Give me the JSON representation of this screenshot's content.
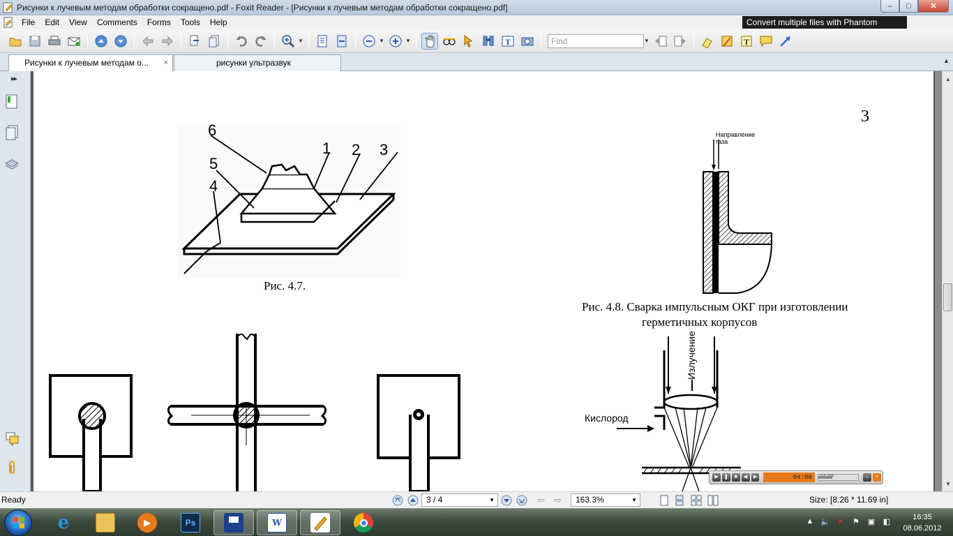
{
  "window": {
    "title": "Рисунки к лучевым методам обработки сокращено.pdf - Foxit Reader - [Рисунки к лучевым методам обработки сокращено.pdf]",
    "min": "–",
    "max": "□",
    "close": "✕"
  },
  "menu": {
    "items": [
      "File",
      "Edit",
      "View",
      "Comments",
      "Forms",
      "Tools",
      "Help"
    ],
    "promo": "Convert multiple files with Phantom"
  },
  "toolbar": {
    "find_placeholder": "Find",
    "icons": [
      "open-icon",
      "save-icon",
      "print-icon",
      "email-icon",
      "prev-page-icon",
      "next-page-icon",
      "back-icon",
      "forward-icon",
      "extract-icon",
      "insert-icon",
      "undo-icon",
      "redo-icon",
      "zoom-in-icon",
      "fit-page-icon",
      "fit-width-icon",
      "zoom-out-icon",
      "zoom-plus-icon",
      "hand-icon",
      "select-text-icon",
      "select-annotation-icon",
      "find-icon",
      "typewriter-icon",
      "snapshot-icon",
      "prev-find-icon",
      "next-find-icon",
      "highlight-icon",
      "note-icon",
      "textbox-icon",
      "comment-icon",
      "arrow-icon"
    ]
  },
  "tabs": [
    {
      "label": "Рисунки к лучевым методам о...",
      "active": true,
      "close": "×"
    },
    {
      "label": "рисунки ультразвук",
      "active": false
    }
  ],
  "document": {
    "page_number": "3",
    "figures": {
      "fig47": {
        "labels": [
          "6",
          "1",
          "2",
          "3",
          "5",
          "4"
        ],
        "caption": "Рис. 4.7."
      },
      "fig48": {
        "label_top": "Направление",
        "label_top2": "газа",
        "caption_line1": "Рис. 4.8. Сварка импульсным ОКГ при изготовлении",
        "caption_line2": "герметичных корпусов"
      },
      "fig49": {
        "label_radiation": "Излучение",
        "label_oxygen": "Кислород"
      }
    }
  },
  "player": {
    "time": "04:00",
    "volume_label": "VOLUME",
    "volume_level": 0.35
  },
  "status": {
    "ready": "Ready",
    "page": "3 / 4",
    "zoom": "163.3%",
    "size": "Size: [8.26 * 11.69 in]"
  },
  "taskbar": {
    "apps": [
      "internet-explorer",
      "file-explorer",
      "media-player",
      "photoshop",
      "save-app",
      "word",
      "foxit-reader",
      "chrome"
    ],
    "time": "16:35",
    "date": "08.06.2012"
  },
  "colors": {
    "titlebar": "#c5d4e4",
    "promo_bg": "#1e1e1e",
    "player_time_bg": "#e87a1a"
  }
}
